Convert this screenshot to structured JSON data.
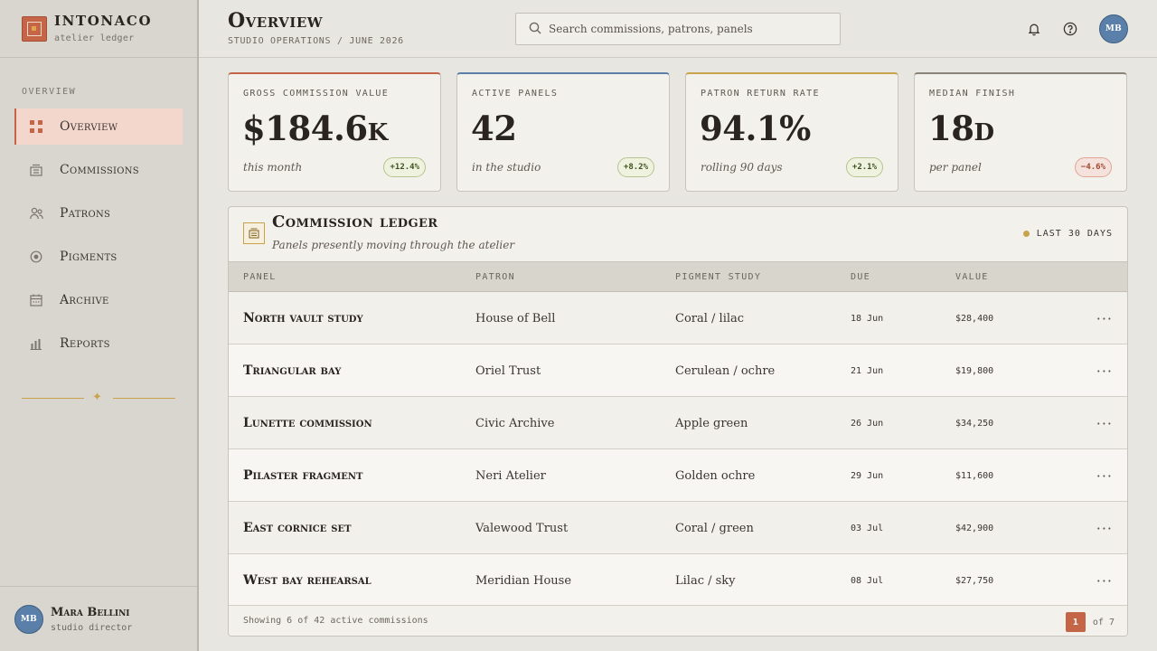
{
  "brand": {
    "name": "INTONACO",
    "subtitle": "atelier ledger"
  },
  "sidebar": {
    "section_label": "OVERVIEW",
    "items": [
      {
        "label": "Overview",
        "icon": "grid-icon",
        "active": true
      },
      {
        "label": "Commissions",
        "icon": "building-icon",
        "active": false
      },
      {
        "label": "Patrons",
        "icon": "users-icon",
        "active": false
      },
      {
        "label": "Pigments",
        "icon": "target-icon",
        "active": false
      },
      {
        "label": "Archive",
        "icon": "calendar-icon",
        "active": false
      },
      {
        "label": "Reports",
        "icon": "bar-chart-icon",
        "active": false
      }
    ],
    "user": {
      "initials": "MB",
      "name": "Mara Bellini",
      "role": "studio director"
    }
  },
  "header": {
    "title": "Overview",
    "subtitle": "STUDIO OPERATIONS / JUNE 2026",
    "search_placeholder": "Search commissions, patrons, panels",
    "avatar_initials": "MB"
  },
  "kpis": [
    {
      "label": "GROSS COMMISSION VALUE",
      "value": "$184.6k",
      "note": "this month",
      "delta": "+12.4%",
      "trend": "up",
      "accent": "#c46548"
    },
    {
      "label": "ACTIVE PANELS",
      "value": "42",
      "note": "in the studio",
      "delta": "+8.2%",
      "trend": "up",
      "accent": "#5a7fa8"
    },
    {
      "label": "PATRON RETURN RATE",
      "value": "94.1%",
      "note": "rolling 90 days",
      "delta": "+2.1%",
      "trend": "up",
      "accent": "#c9a24c"
    },
    {
      "label": "MEDIAN FINISH",
      "value": "18d",
      "note": "per panel",
      "delta": "−4.6%",
      "trend": "down",
      "accent": "#8a8478"
    }
  ],
  "ledger": {
    "title": "Commission ledger",
    "subtitle": "Panels presently moving through the atelier",
    "range": "LAST 30 DAYS",
    "columns": [
      "PANEL",
      "PATRON",
      "PIGMENT STUDY",
      "DUE",
      "VALUE"
    ],
    "rows": [
      {
        "panel": "North vault study",
        "patron": "House of Bell",
        "pigment": "Coral / lilac",
        "due": "18 Jun",
        "value": "$28,400"
      },
      {
        "panel": "Triangular bay",
        "patron": "Oriel Trust",
        "pigment": "Cerulean / ochre",
        "due": "21 Jun",
        "value": "$19,800"
      },
      {
        "panel": "Lunette commission",
        "patron": "Civic Archive",
        "pigment": "Apple green",
        "due": "26 Jun",
        "value": "$34,250"
      },
      {
        "panel": "Pilaster fragment",
        "patron": "Neri Atelier",
        "pigment": "Golden ochre",
        "due": "29 Jun",
        "value": "$11,600"
      },
      {
        "panel": "East cornice set",
        "patron": "Valewood Trust",
        "pigment": "Coral / green",
        "due": "03 Jul",
        "value": "$42,900"
      },
      {
        "panel": "West bay rehearsal",
        "patron": "Meridian House",
        "pigment": "Lilac / sky",
        "due": "08 Jul",
        "value": "$27,750"
      }
    ],
    "footer_text": "Showing 6 of 42 active commissions",
    "page": "1",
    "page_total": "of 7"
  }
}
